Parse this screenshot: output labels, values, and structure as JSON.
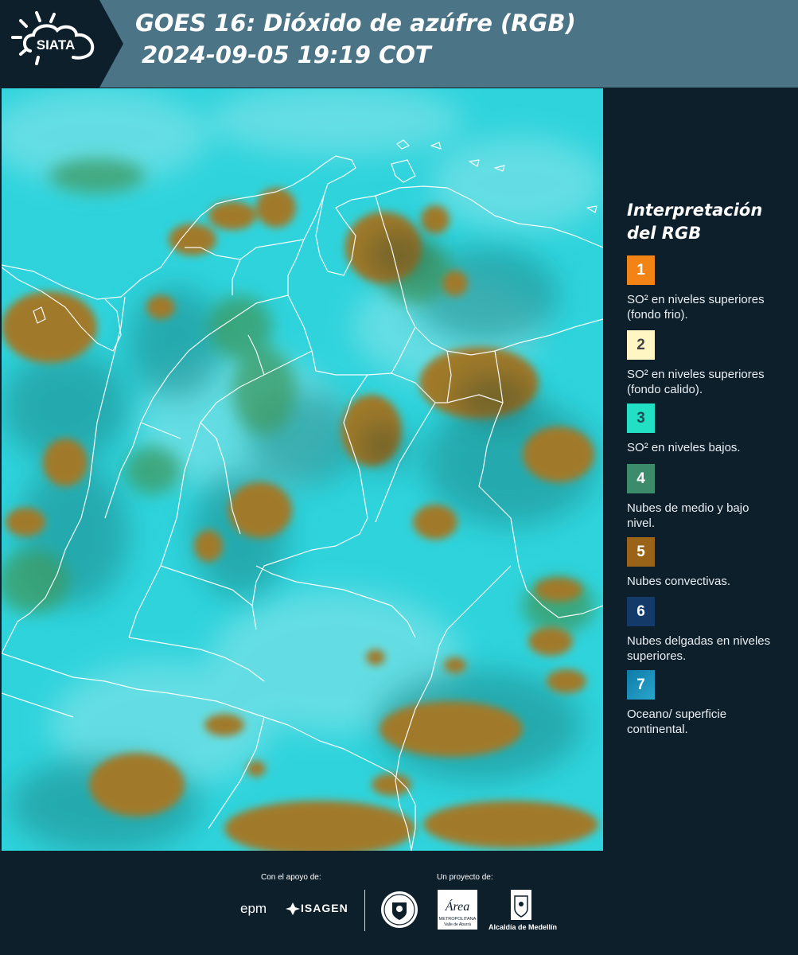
{
  "header": {
    "logo_text": "SIATA",
    "title_line1": "GOES 16: Dióxido de azúfre (RGB)",
    "title_line2": "2024-09-05 19:19 COT"
  },
  "map": {
    "description_icon": "satellite-map",
    "colors": {
      "background": "#2fd2dc",
      "convective_cloud": "#9b7a2e",
      "mid_low_cloud": "#3d9a6a",
      "border_line": "#ffffff"
    }
  },
  "legend": {
    "title": "Interpretación del RGB",
    "items": [
      {
        "number": "1",
        "color": "#f28416",
        "number_color": "#ffffff",
        "text": "SO² en niveles superiores (fondo frio)."
      },
      {
        "number": "2",
        "color": "#fff6c4",
        "number_color": "#444444",
        "text": "SO² en niveles superiores (fondo calido)."
      },
      {
        "number": "3",
        "color": "#22e0c4",
        "number_color": "#1a4a55",
        "text": "SO² en niveles bajos."
      },
      {
        "number": "4",
        "color": "#3c8c6c",
        "number_color": "#ffffff",
        "text": "Nubes de medio y bajo nivel."
      },
      {
        "number": "5",
        "color": "#9a6418",
        "number_color": "#ffffff",
        "text": "Nubes convectivas."
      },
      {
        "number": "6",
        "color": "#143a6a",
        "number_color": "#ffffff",
        "text": "Nubes delgadas en niveles superiores."
      },
      {
        "number": "7",
        "color": "#1c8ab4",
        "number_color": "#ffffff",
        "text": "Oceano/ superficie continental."
      }
    ]
  },
  "footer": {
    "support_label": "Con el apoyo de:",
    "project_label": "Un proyecto de:",
    "epm_text": "epm",
    "isagen_text": "ISAGEN",
    "area_text": "Área",
    "area_sub": "METROPOLITANA",
    "area_sub2": "Valle de Aburrá",
    "alcaldia_text": "Alcaldía de Medellín"
  }
}
